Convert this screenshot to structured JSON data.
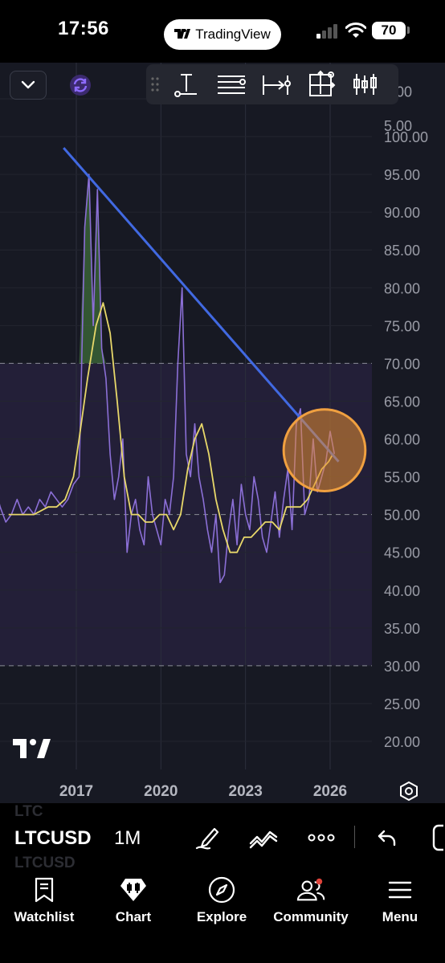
{
  "status_bar": {
    "time": "17:56",
    "pill_label": "TradingView",
    "battery": "70"
  },
  "chart_toolbar": {
    "tools": [
      "text-anchor-icon",
      "horizontal-lines-icon",
      "measure-range-icon",
      "crosshair-box-icon",
      "candles-icon"
    ]
  },
  "chart_data": {
    "type": "line",
    "title": "",
    "y_ticks": [
      "0.00",
      "5.00",
      "100.00",
      "95.00",
      "90.00",
      "85.00",
      "80.00",
      "75.00",
      "70.00",
      "65.00",
      "60.00",
      "55.00",
      "50.00",
      "45.00",
      "40.00",
      "35.00",
      "30.00",
      "25.00",
      "20.00"
    ],
    "x_ticks": [
      "2017",
      "2020",
      "2023",
      "2026"
    ],
    "ylim": [
      17,
      106
    ],
    "xlim": [
      2014.1,
      2028.4
    ],
    "bands": {
      "upper": 70,
      "middle": 50,
      "lower": 30
    },
    "series": [
      {
        "color": "#8b6fd6",
        "x": [
          2014.1,
          2014.3,
          2014.5,
          2014.7,
          2014.9,
          2015.1,
          2015.3,
          2015.5,
          2015.7,
          2015.9,
          2016.1,
          2016.3,
          2016.5,
          2016.7,
          2016.9,
          2017.1,
          2017.3,
          2017.45,
          2017.6,
          2017.75,
          2017.9,
          2018.05,
          2018.2,
          2018.35,
          2018.5,
          2018.65,
          2018.8,
          2018.95,
          2019.1,
          2019.25,
          2019.4,
          2019.55,
          2019.7,
          2019.85,
          2020.0,
          2020.15,
          2020.3,
          2020.45,
          2020.6,
          2020.75,
          2020.9,
          2021.05,
          2021.2,
          2021.35,
          2021.5,
          2021.65,
          2021.8,
          2021.95,
          2022.1,
          2022.25,
          2022.4,
          2022.55,
          2022.7,
          2022.85,
          2023.0,
          2023.15,
          2023.3,
          2023.45,
          2023.6,
          2023.75,
          2023.9,
          2024.05,
          2024.2,
          2024.35,
          2024.5,
          2024.65,
          2024.8,
          2024.95,
          2025.1,
          2025.25,
          2025.4,
          2025.55,
          2025.7,
          2025.85,
          2026.0,
          2026.15
        ],
        "values": [
          54,
          51,
          49,
          50,
          52,
          50,
          51,
          50,
          52,
          51,
          53,
          52,
          51,
          52,
          54,
          55,
          88,
          95,
          75,
          93,
          72,
          68,
          58,
          52,
          55,
          60,
          45,
          50,
          52,
          48,
          46,
          55,
          50,
          48,
          46,
          52,
          50,
          55,
          70,
          80,
          58,
          55,
          62,
          55,
          52,
          48,
          45,
          50,
          41,
          42,
          48,
          52,
          46,
          54,
          50,
          48,
          55,
          52,
          47,
          45,
          49,
          53,
          47,
          52,
          56,
          48,
          62,
          64,
          50,
          52,
          60,
          53,
          55,
          57,
          61,
          58
        ],
        "values_note": "ignore"
      },
      {
        "color": "#e8d86a",
        "x": [
          2014.6,
          2015.0,
          2015.5,
          2016.0,
          2016.3,
          2016.6,
          2016.9,
          2017.1,
          2017.4,
          2017.7,
          2017.95,
          2018.2,
          2018.45,
          2018.7,
          2018.95,
          2019.2,
          2019.45,
          2019.7,
          2019.95,
          2020.2,
          2020.45,
          2020.7,
          2020.95,
          2021.2,
          2021.45,
          2021.7,
          2021.95,
          2022.2,
          2022.45,
          2022.7,
          2022.95,
          2023.2,
          2023.45,
          2023.7,
          2023.95,
          2024.2,
          2024.45,
          2024.7,
          2024.95,
          2025.2,
          2025.45,
          2025.7,
          2025.95,
          2026.1
        ],
        "values": [
          50,
          50,
          50,
          51,
          51,
          52,
          55,
          60,
          68,
          75,
          78,
          74,
          65,
          55,
          50,
          50,
          49,
          49,
          50,
          50,
          48,
          50,
          56,
          60,
          62,
          58,
          52,
          48,
          45,
          45,
          47,
          47,
          48,
          49,
          49,
          48,
          51,
          51,
          51,
          52,
          54,
          56,
          57,
          58
        ]
      }
    ],
    "trendline": {
      "from": [
        2016.55,
        98.5
      ],
      "to": [
        2026.3,
        57
      ]
    },
    "highlight": {
      "center": [
        2025.8,
        58.5
      ],
      "radius_y": 5.4
    }
  },
  "symbol_bar": {
    "ghost_top": "LTC",
    "symbol": "LTCUSD",
    "interval": "1M",
    "ghost_bottom": "LTCUSD"
  },
  "nav": {
    "items": [
      {
        "label": "Watchlist"
      },
      {
        "label": "Chart"
      },
      {
        "label": "Explore"
      },
      {
        "label": "Community"
      },
      {
        "label": "Menu"
      }
    ]
  }
}
